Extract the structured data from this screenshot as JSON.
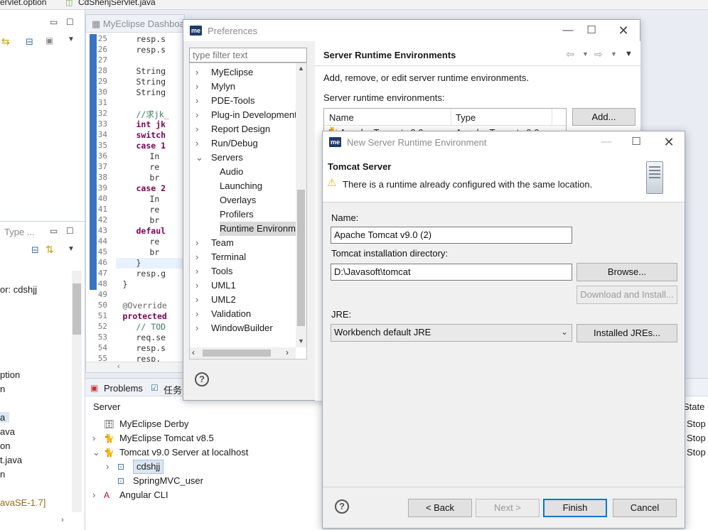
{
  "topbar": {
    "path": "ervlet.option",
    "file": "CdShenjServlet.java"
  },
  "editor": {
    "tab": "MyEclipse Dashboa",
    "lines": [
      {
        "n": "25",
        "c": "resp.s"
      },
      {
        "n": "26",
        "c": "resp.s"
      },
      {
        "n": "27",
        "c": ""
      },
      {
        "n": "28",
        "c": "String"
      },
      {
        "n": "29",
        "c": "String"
      },
      {
        "n": "30",
        "c": "String"
      },
      {
        "n": "31",
        "c": ""
      },
      {
        "n": "32",
        "c": "//求jk_"
      },
      {
        "n": "33",
        "c": "int jk"
      },
      {
        "n": "34",
        "c": "switch"
      },
      {
        "n": "35",
        "c": "case 1"
      },
      {
        "n": "36",
        "c": "In"
      },
      {
        "n": "37",
        "c": "re"
      },
      {
        "n": "38",
        "c": "br"
      },
      {
        "n": "39",
        "c": "case 2"
      },
      {
        "n": "40",
        "c": "In"
      },
      {
        "n": "41",
        "c": "re"
      },
      {
        "n": "42",
        "c": "br"
      },
      {
        "n": "43",
        "c": "defaul"
      },
      {
        "n": "44",
        "c": "re"
      },
      {
        "n": "45",
        "c": "br"
      },
      {
        "n": "46",
        "c": "}"
      },
      {
        "n": "47",
        "c": "resp.g"
      },
      {
        "n": "48",
        "c": "}"
      },
      {
        "n": "49",
        "c": ""
      },
      {
        "n": "50",
        "c": "@Override"
      },
      {
        "n": "51",
        "c": "protected"
      },
      {
        "n": "52",
        "c": "// TOD"
      },
      {
        "n": "53",
        "c": "req.se"
      },
      {
        "n": "54",
        "c": "resp.s"
      },
      {
        "n": "55",
        "c": "resp."
      }
    ]
  },
  "leftpane": {
    "typeTab": "Type ...",
    "items": [
      "or: cdshjj",
      "ption",
      "n",
      "a",
      "ava",
      "on",
      "t.java",
      "n",
      "avaSE-1.7]"
    ]
  },
  "bottom": {
    "problemsTab": "Problems",
    "tasksTab": "任务",
    "serverHeader": "Server",
    "stateHeader": "State",
    "servers": [
      {
        "label": "MyEclipse Derby",
        "state": "Stop"
      },
      {
        "label": "MyEclipse Tomcat v8.5",
        "state": "Stop"
      },
      {
        "label": "Tomcat v9.0 Server at localhost",
        "state": "Stop"
      },
      {
        "label": "cdshjj",
        "state": ""
      },
      {
        "label": "SpringMVC_user",
        "state": ""
      },
      {
        "label": "Angular CLI",
        "state": ""
      }
    ]
  },
  "prefs": {
    "title": "Preferences",
    "filterPlaceholder": "type filter text",
    "tree": [
      "MyEclipse",
      "Mylyn",
      "PDE-Tools",
      "Plug-in Development",
      "Report Design",
      "Run/Debug",
      "Servers",
      "Audio",
      "Launching",
      "Overlays",
      "Profilers",
      "Runtime Environm",
      "Team",
      "Terminal",
      "Tools",
      "UML1",
      "UML2",
      "Validation",
      "WindowBuilder"
    ],
    "pageTitle": "Server Runtime Environments",
    "description": "Add, remove, or edit server runtime environments.",
    "listLabel": "Server runtime environments:",
    "colName": "Name",
    "colType": "Type",
    "rowName": "Apache Tomcat v9.0",
    "rowType": "Apache Tomcat v9.0",
    "addButton": "Add...",
    "helpGlyph": "?"
  },
  "newServer": {
    "title": "New Server Runtime Environment",
    "heading": "Tomcat Server",
    "warning": "There is a runtime already configured with the same location.",
    "nameLabel": "Name:",
    "nameValue": "Apache Tomcat v9.0 (2)",
    "dirLabel": "Tomcat installation directory:",
    "dirValue": "D:\\Javasoft\\tomcat",
    "browse": "Browse...",
    "download": "Download and Install...",
    "jreLabel": "JRE:",
    "jreValue": "Workbench default JRE",
    "installedJres": "Installed JREs...",
    "back": "< Back",
    "next": "Next >",
    "finish": "Finish",
    "cancel": "Cancel",
    "helpGlyph": "?"
  },
  "colors": {
    "accent": "#0078d7",
    "warning": "#f0b400"
  }
}
